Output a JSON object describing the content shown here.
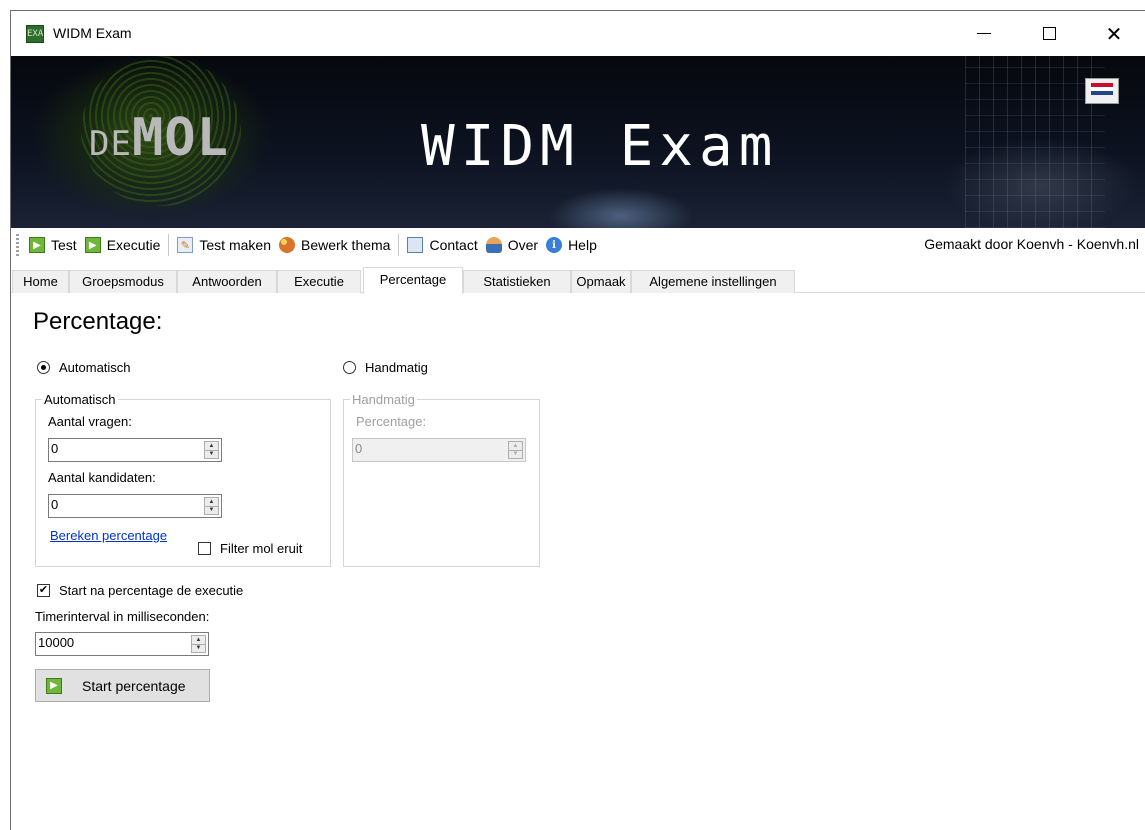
{
  "window": {
    "title": "WIDM Exam",
    "app_icon_text": "EXA"
  },
  "banner": {
    "logo_de": "DE",
    "logo_mol": "MOL",
    "title": "WIDM Exam"
  },
  "toolbar": {
    "items": [
      {
        "label": "Test",
        "icon": "play-icon"
      },
      {
        "label": "Executie",
        "icon": "play-icon"
      },
      {
        "label": "Test maken",
        "icon": "edit-icon"
      },
      {
        "label": "Bewerk thema",
        "icon": "theme-icon"
      },
      {
        "label": "Contact",
        "icon": "mail-icon"
      },
      {
        "label": "Over",
        "icon": "user-icon"
      },
      {
        "label": "Help",
        "icon": "help-icon"
      }
    ],
    "credit": "Gemaakt door Koenvh - Koenvh.nl"
  },
  "tabs": [
    "Home",
    "Groepsmodus",
    "Antwoorden",
    "Executie",
    "Percentage",
    "Statistieken",
    "Opmaak",
    "Algemene instellingen"
  ],
  "active_tab": "Percentage",
  "main": {
    "title": "Percentage:",
    "radio_auto": "Automatisch",
    "radio_manual": "Handmatig",
    "auto_group": {
      "legend": "Automatisch",
      "questions_label": "Aantal vragen:",
      "questions_value": "0",
      "candidates_label": "Aantal kandidaten:",
      "candidates_value": "0",
      "calc_link": "Bereken percentage",
      "filter_label": "Filter mol eruit"
    },
    "manual_group": {
      "legend": "Handmatig",
      "percentage_label": "Percentage:",
      "percentage_value": "0"
    },
    "start_exec_label": "Start na percentage de executie",
    "timer_label": "Timerinterval in milliseconden:",
    "timer_value": "10000",
    "start_button": "Start percentage"
  },
  "colors": {
    "link": "#0033cc",
    "play_icon": "#6fb63a",
    "banner_bg": "#0c1220"
  }
}
